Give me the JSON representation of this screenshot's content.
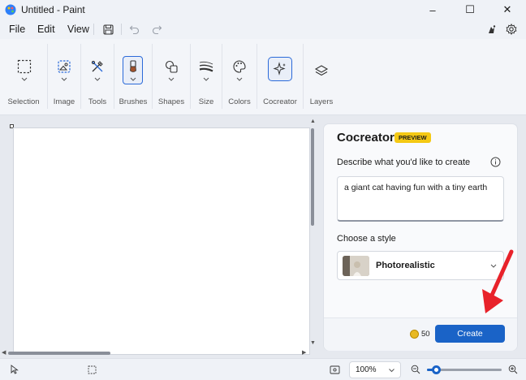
{
  "window": {
    "title": "Untitled - Paint",
    "controls": {
      "minimize": "–",
      "maximize": "☐",
      "close": "✕"
    }
  },
  "menu": {
    "items": [
      "File",
      "Edit",
      "View"
    ],
    "quick_actions": [
      "save-icon",
      "undo-icon",
      "redo-icon"
    ],
    "right_icons": [
      "accessibility-icon",
      "settings-icon"
    ]
  },
  "toolbar": {
    "groups": [
      {
        "label": "Selection",
        "icon": "selection-icon"
      },
      {
        "label": "Image",
        "icon": "image-icon"
      },
      {
        "label": "Tools",
        "icon": "tools-icon"
      },
      {
        "label": "Brushes",
        "icon": "brush-icon"
      },
      {
        "label": "Shapes",
        "icon": "shapes-icon"
      },
      {
        "label": "Size",
        "icon": "size-icon"
      },
      {
        "label": "Colors",
        "icon": "palette-icon"
      },
      {
        "label": "Cocreator",
        "icon": "cocreator-icon"
      },
      {
        "label": "Layers",
        "icon": "layers-icon"
      }
    ],
    "active_group": "Cocreator"
  },
  "cocreator": {
    "title": "Cocreator",
    "badge": "PREVIEW",
    "describe_label": "Describe what you'd like to create",
    "prompt_value": "a giant cat having fun with a tiny earth",
    "style_label": "Choose a style",
    "style_value": "Photorealistic",
    "credits": "50",
    "create_label": "Create"
  },
  "status": {
    "zoom_value": "100%",
    "zoom_level": 0.12
  },
  "colors": {
    "accent": "#1a63c7",
    "badge": "#f4c914",
    "annotation_arrow": "#e8222a"
  }
}
